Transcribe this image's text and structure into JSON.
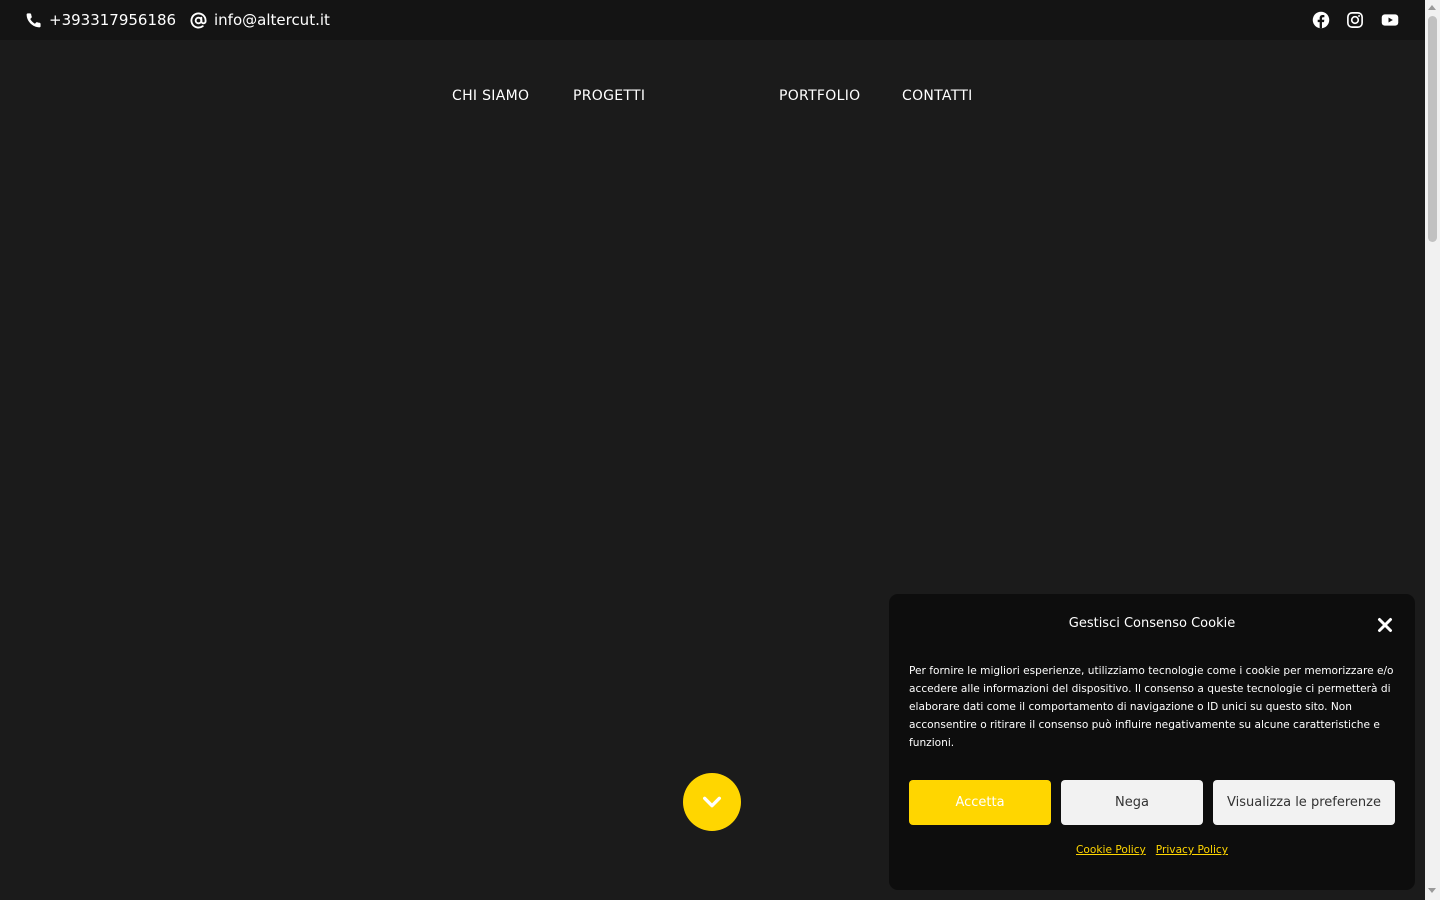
{
  "topbar": {
    "phone": "+393317956186",
    "email": "info@altercut.it",
    "social": [
      "facebook-icon",
      "instagram-icon",
      "youtube-icon"
    ]
  },
  "nav": {
    "items": [
      {
        "label": "CHI SIAMO"
      },
      {
        "label": "PROGETTI"
      },
      {
        "label": "PORTFOLIO"
      },
      {
        "label": "CONTATTI"
      }
    ]
  },
  "cookie_banner": {
    "title": "Gestisci Consenso Cookie",
    "body": "Per fornire le migliori esperienze, utilizziamo tecnologie come i cookie per memorizzare e/o accedere alle informazioni del dispositivo. Il consenso a queste tecnologie ci permetterà di elaborare dati come il comportamento di navigazione o ID unici su questo sito. Non acconsentire o ritirare il consenso può influire negativamente su alcune caratteristiche e funzioni.",
    "accept_label": "Accetta",
    "deny_label": "Nega",
    "prefs_label": "Visualizza le preferenze",
    "links": [
      "Cookie Policy",
      "Privacy Policy"
    ]
  },
  "colors": {
    "background": "#1b1b1b",
    "topbar": "#141414",
    "accent": "#ffd600",
    "dialog": "#0d0d0d"
  }
}
